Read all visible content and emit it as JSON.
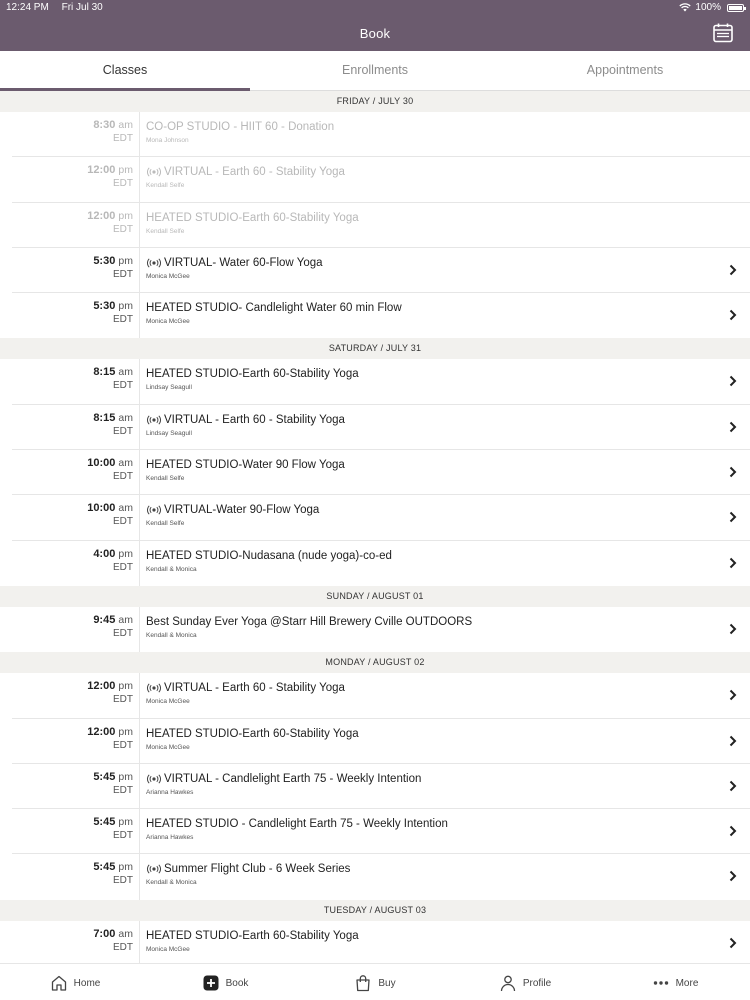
{
  "status": {
    "time": "12:24 PM",
    "date": "Fri Jul 30",
    "battery": "100%"
  },
  "header": {
    "title": "Book"
  },
  "tabs": [
    {
      "label": "Classes",
      "active": true
    },
    {
      "label": "Enrollments",
      "active": false
    },
    {
      "label": "Appointments",
      "active": false
    }
  ],
  "days": [
    {
      "label": "FRIDAY / JULY 30",
      "classes": [
        {
          "time": "8:30",
          "ampm": "am",
          "tz": "EDT",
          "name": "CO-OP STUDIO - HIIT 60 - Donation",
          "instructor": "Mona Johnson",
          "virtual": false,
          "past": true
        },
        {
          "time": "12:00",
          "ampm": "pm",
          "tz": "EDT",
          "name": "VIRTUAL - Earth 60 - Stability Yoga",
          "instructor": "Kendall Selfe",
          "virtual": true,
          "past": true
        },
        {
          "time": "12:00",
          "ampm": "pm",
          "tz": "EDT",
          "name": "HEATED STUDIO-Earth 60-Stability Yoga",
          "instructor": "Kendall Selfe",
          "virtual": false,
          "past": true
        },
        {
          "time": "5:30",
          "ampm": "pm",
          "tz": "EDT",
          "name": "VIRTUAL- Water 60-Flow Yoga",
          "instructor": "Monica McGee",
          "virtual": true,
          "past": false
        },
        {
          "time": "5:30",
          "ampm": "pm",
          "tz": "EDT",
          "name": "HEATED STUDIO- Candlelight Water 60 min Flow",
          "instructor": "Monica McGee",
          "virtual": false,
          "past": false
        }
      ]
    },
    {
      "label": "SATURDAY / JULY 31",
      "classes": [
        {
          "time": "8:15",
          "ampm": "am",
          "tz": "EDT",
          "name": "HEATED STUDIO-Earth 60-Stability Yoga",
          "instructor": "Lindsay Seagull",
          "virtual": false,
          "past": false
        },
        {
          "time": "8:15",
          "ampm": "am",
          "tz": "EDT",
          "name": "VIRTUAL - Earth 60 - Stability Yoga",
          "instructor": "Lindsay Seagull",
          "virtual": true,
          "past": false
        },
        {
          "time": "10:00",
          "ampm": "am",
          "tz": "EDT",
          "name": "HEATED STUDIO-Water 90 Flow Yoga",
          "instructor": "Kendall Selfe",
          "virtual": false,
          "past": false
        },
        {
          "time": "10:00",
          "ampm": "am",
          "tz": "EDT",
          "name": "VIRTUAL-Water 90-Flow Yoga",
          "instructor": "Kendall Selfe",
          "virtual": true,
          "past": false
        },
        {
          "time": "4:00",
          "ampm": "pm",
          "tz": "EDT",
          "name": "HEATED STUDIO-Nudasana (nude yoga)-co-ed",
          "instructor": "Kendall & Monica",
          "virtual": false,
          "past": false
        }
      ]
    },
    {
      "label": "SUNDAY / AUGUST 01",
      "classes": [
        {
          "time": "9:45",
          "ampm": "am",
          "tz": "EDT",
          "name": "Best Sunday Ever Yoga @Starr Hill Brewery Cville OUTDOORS",
          "instructor": "Kendall & Monica",
          "virtual": false,
          "past": false
        }
      ]
    },
    {
      "label": "MONDAY / AUGUST 02",
      "classes": [
        {
          "time": "12:00",
          "ampm": "pm",
          "tz": "EDT",
          "name": "VIRTUAL - Earth 60 - Stability Yoga",
          "instructor": "Monica McGee",
          "virtual": true,
          "past": false
        },
        {
          "time": "12:00",
          "ampm": "pm",
          "tz": "EDT",
          "name": "HEATED STUDIO-Earth 60-Stability Yoga",
          "instructor": "Monica McGee",
          "virtual": false,
          "past": false
        },
        {
          "time": "5:45",
          "ampm": "pm",
          "tz": "EDT",
          "name": "VIRTUAL - Candlelight Earth 75 - Weekly Intention",
          "instructor": "Arianna Hawkes",
          "virtual": true,
          "past": false
        },
        {
          "time": "5:45",
          "ampm": "pm",
          "tz": "EDT",
          "name": "HEATED STUDIO - Candlelight Earth 75 - Weekly Intention",
          "instructor": "Arianna Hawkes",
          "virtual": false,
          "past": false
        },
        {
          "time": "5:45",
          "ampm": "pm",
          "tz": "EDT",
          "name": "Summer Flight Club - 6 Week Series",
          "instructor": "Kendall & Monica",
          "virtual": true,
          "past": false
        }
      ]
    },
    {
      "label": "TUESDAY / AUGUST 03",
      "classes": [
        {
          "time": "7:00",
          "ampm": "am",
          "tz": "EDT",
          "name": "HEATED STUDIO-Earth 60-Stability Yoga",
          "instructor": "Monica McGee",
          "virtual": false,
          "past": false
        }
      ]
    }
  ],
  "bottom_nav": [
    {
      "label": "Home",
      "icon": "home-icon"
    },
    {
      "label": "Book",
      "icon": "book-plus-icon"
    },
    {
      "label": "Buy",
      "icon": "bag-icon"
    },
    {
      "label": "Profile",
      "icon": "profile-icon"
    },
    {
      "label": "More",
      "icon": "more-icon"
    }
  ],
  "colors": {
    "accent": "#6b5b6e",
    "day_header_bg": "#f2f1ee"
  }
}
